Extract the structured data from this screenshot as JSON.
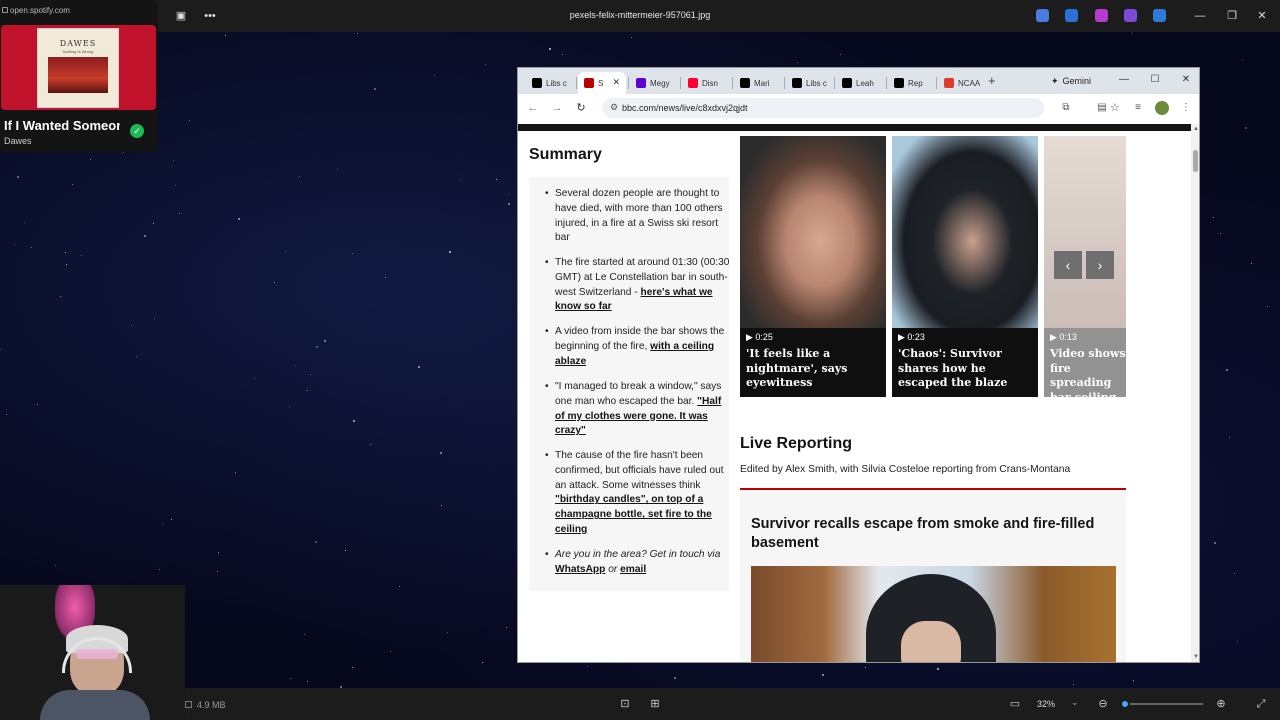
{
  "viewer": {
    "title": "pexels-felix-mittermeier-957061.jpg",
    "file_size": "4.9 MB",
    "zoom": "32%",
    "zoom_fraction": 0.32
  },
  "spotify": {
    "url": "open.spotify.com",
    "cover_band": "DAWES",
    "cover_subtitle": "Nothing Is Wrong",
    "track_title": "If I Wanted Someone",
    "artist": "Dawes"
  },
  "browser": {
    "tabs": [
      {
        "label": "Libs c",
        "icon": "x-logo-icon",
        "color": "#000000"
      },
      {
        "label": "S",
        "icon": "bbc-logo-icon",
        "color": "#b80000",
        "active": true
      },
      {
        "label": "Megy",
        "icon": "yahoo-logo-icon",
        "color": "#6001d2"
      },
      {
        "label": "Disn",
        "icon": "youtube-logo-icon",
        "color": "#ff0033"
      },
      {
        "label": "Mari",
        "icon": "x-logo-icon",
        "color": "#000000"
      },
      {
        "label": "Libs c",
        "icon": "x-logo-icon",
        "color": "#000000"
      },
      {
        "label": "Leah",
        "icon": "x-logo-icon",
        "color": "#000000"
      },
      {
        "label": "Rep",
        "icon": "x-logo-icon",
        "color": "#000000"
      },
      {
        "label": "NCAA",
        "icon": "ncaa-logo-icon",
        "color": "#e03a2e"
      }
    ],
    "gemini_label": "Gemini",
    "url": "bbc.com/news/live/c8xdxvj2qjdt"
  },
  "summary": {
    "heading": "Summary",
    "items": [
      {
        "text": "Several dozen people are thought to have died, with more than 100 others injured, in a fire at a Swiss ski resort bar"
      },
      {
        "text": "The fire started at around 01:30 (00:30 GMT) at Le Constellation bar in south-west Switzerland - ",
        "link": "here's what we know so far"
      },
      {
        "text": "A video from inside the bar shows the beginning of the fire, ",
        "link": "with a ceiling ablaze"
      },
      {
        "text": "\"I managed to break a window,\" says one man who escaped the bar. ",
        "link": "\"Half of my clothes were gone. It was crazy\""
      },
      {
        "text": "The cause of the fire hasn't been confirmed, but officials have ruled out an attack. Some witnesses think ",
        "link": "\"birthday candles\", on top of a champagne bottle, set fire to the ceiling"
      },
      {
        "italic": "Are you in the area? Get in touch via ",
        "link1": "WhatsApp",
        "mid": " or ",
        "link2": "email"
      }
    ]
  },
  "videos": [
    {
      "duration": "0:25",
      "title": "'It feels like a nightmare', says eyewitness"
    },
    {
      "duration": "0:23",
      "title": "'Chaos': Survivor shares how he escaped the blaze"
    },
    {
      "duration": "0:13",
      "title": "Video shows fire spreading bar ceiling"
    }
  ],
  "live": {
    "heading": "Live Reporting",
    "edited_by": "Edited by Alex Smith, with Silvia Costeloe reporting from Crans-Montana",
    "post_title": "Survivor recalls escape from smoke and fire-filled basement"
  }
}
